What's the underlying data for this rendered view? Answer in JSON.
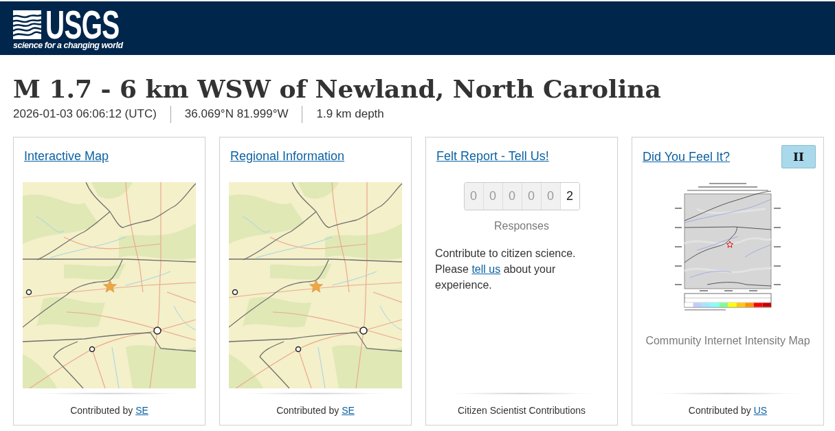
{
  "header": {
    "logo": {
      "wordmark": "USGS",
      "tagline": "science for a changing world"
    }
  },
  "event": {
    "title": "M 1.7 - 6 km WSW of Newland, North Carolina",
    "details": [
      "2026-01-03 06:06:12 (UTC)",
      "36.069°N 81.999°W",
      "1.9 km depth"
    ]
  },
  "cards": [
    {
      "kind": "map",
      "title": "Interactive Map",
      "footer": {
        "text": "Contributed by",
        "link": "SE"
      }
    },
    {
      "kind": "map",
      "title": "Regional Information",
      "footer": {
        "text": "Contributed by",
        "link": "SE"
      }
    },
    {
      "kind": "felt",
      "title": "Felt Report - Tell Us!",
      "digits": [
        {
          "value": "0",
          "active": false
        },
        {
          "value": "0",
          "active": false
        },
        {
          "value": "0",
          "active": false
        },
        {
          "value": "0",
          "active": false
        },
        {
          "value": "0",
          "active": false
        },
        {
          "value": "2",
          "active": true
        }
      ],
      "caption": "Responses",
      "body": {
        "before": "Contribute to citizen science. Please",
        "link": "tell us",
        "after": "about your experience."
      },
      "footer": {
        "text": "Citizen Scientist Contributions"
      }
    },
    {
      "kind": "dyfi",
      "title": "Did You Feel It?",
      "badge": "II",
      "caption": "Community Internet Intensity Map",
      "footer": {
        "text": "Contributed by",
        "link": "US"
      }
    }
  ]
}
